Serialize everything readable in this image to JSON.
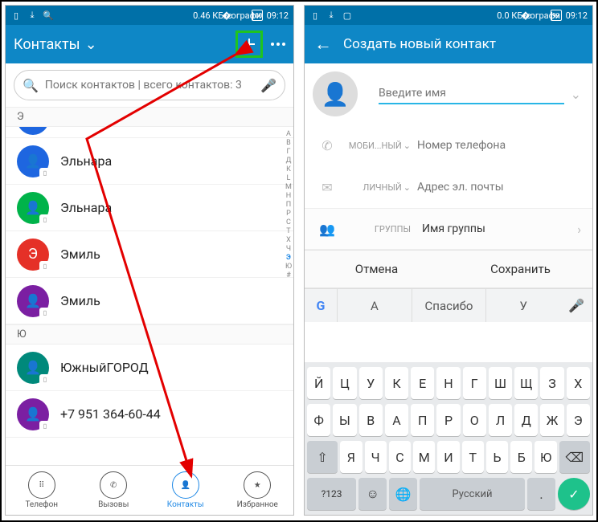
{
  "statusbar": {
    "speed_left": "0.46 КБ/с",
    "speed_right": "0.0 КБ/с",
    "battery_left": "100",
    "battery_right": "99",
    "time": "09:12"
  },
  "left": {
    "title": "Контакты",
    "search_placeholder": "Поиск контактов | всего контактов: 3",
    "sections": [
      {
        "letter": "Э",
        "contacts": [
          {
            "name": "Эльнара",
            "color": "#1e66e0"
          },
          {
            "name": "Эльнара",
            "color": "#00b34a"
          },
          {
            "name": "Эмиль",
            "color": "#e53027",
            "initial": "Э"
          },
          {
            "name": "Эмиль",
            "color": "#7b1fa2"
          }
        ]
      },
      {
        "letter": "Ю",
        "contacts": [
          {
            "name": "ЮжныйГОРОД",
            "color": "#00897b"
          },
          {
            "name": "+7 951 364-60-44",
            "color": "#7b1fa2"
          }
        ]
      }
    ],
    "alpha_index": [
      "А",
      "В",
      "Г",
      "Д",
      "К",
      "L",
      "М",
      "Н",
      "П",
      "Р",
      "С",
      "Т",
      "Х",
      "Ч",
      "Э",
      "Ю",
      "#"
    ],
    "alpha_highlight": "Э",
    "nav": [
      {
        "label": "Телефон"
      },
      {
        "label": "Вызовы"
      },
      {
        "label": "Контакты"
      },
      {
        "label": "Избранное"
      }
    ]
  },
  "right": {
    "title": "Создать новый контакт",
    "name_placeholder": "Введите имя",
    "phone_label": "МОБИ...НЫЙ",
    "phone_placeholder": "Номер телефона",
    "email_label": "ЛИЧНЫЙ",
    "email_placeholder": "Адрес эл. почты",
    "group_label": "ГРУППЫ",
    "group_value": "Имя группы",
    "cancel": "Отмена",
    "save": "Сохранить",
    "suggestions": [
      "А",
      "Спасибо",
      "У"
    ],
    "kb_row1": [
      "Й",
      "Ц",
      "У",
      "К",
      "Е",
      "Н",
      "Г",
      "Ш",
      "Щ",
      "З",
      "Х"
    ],
    "kb_row2": [
      "Ф",
      "Ы",
      "В",
      "А",
      "П",
      "Р",
      "О",
      "Л",
      "Д",
      "Ж",
      "Э"
    ],
    "kb_row3": [
      "Я",
      "Ч",
      "С",
      "М",
      "И",
      "Т",
      "Ь",
      "Б",
      "Ю"
    ],
    "kb_sym": "?123",
    "kb_lang": "Русский"
  }
}
